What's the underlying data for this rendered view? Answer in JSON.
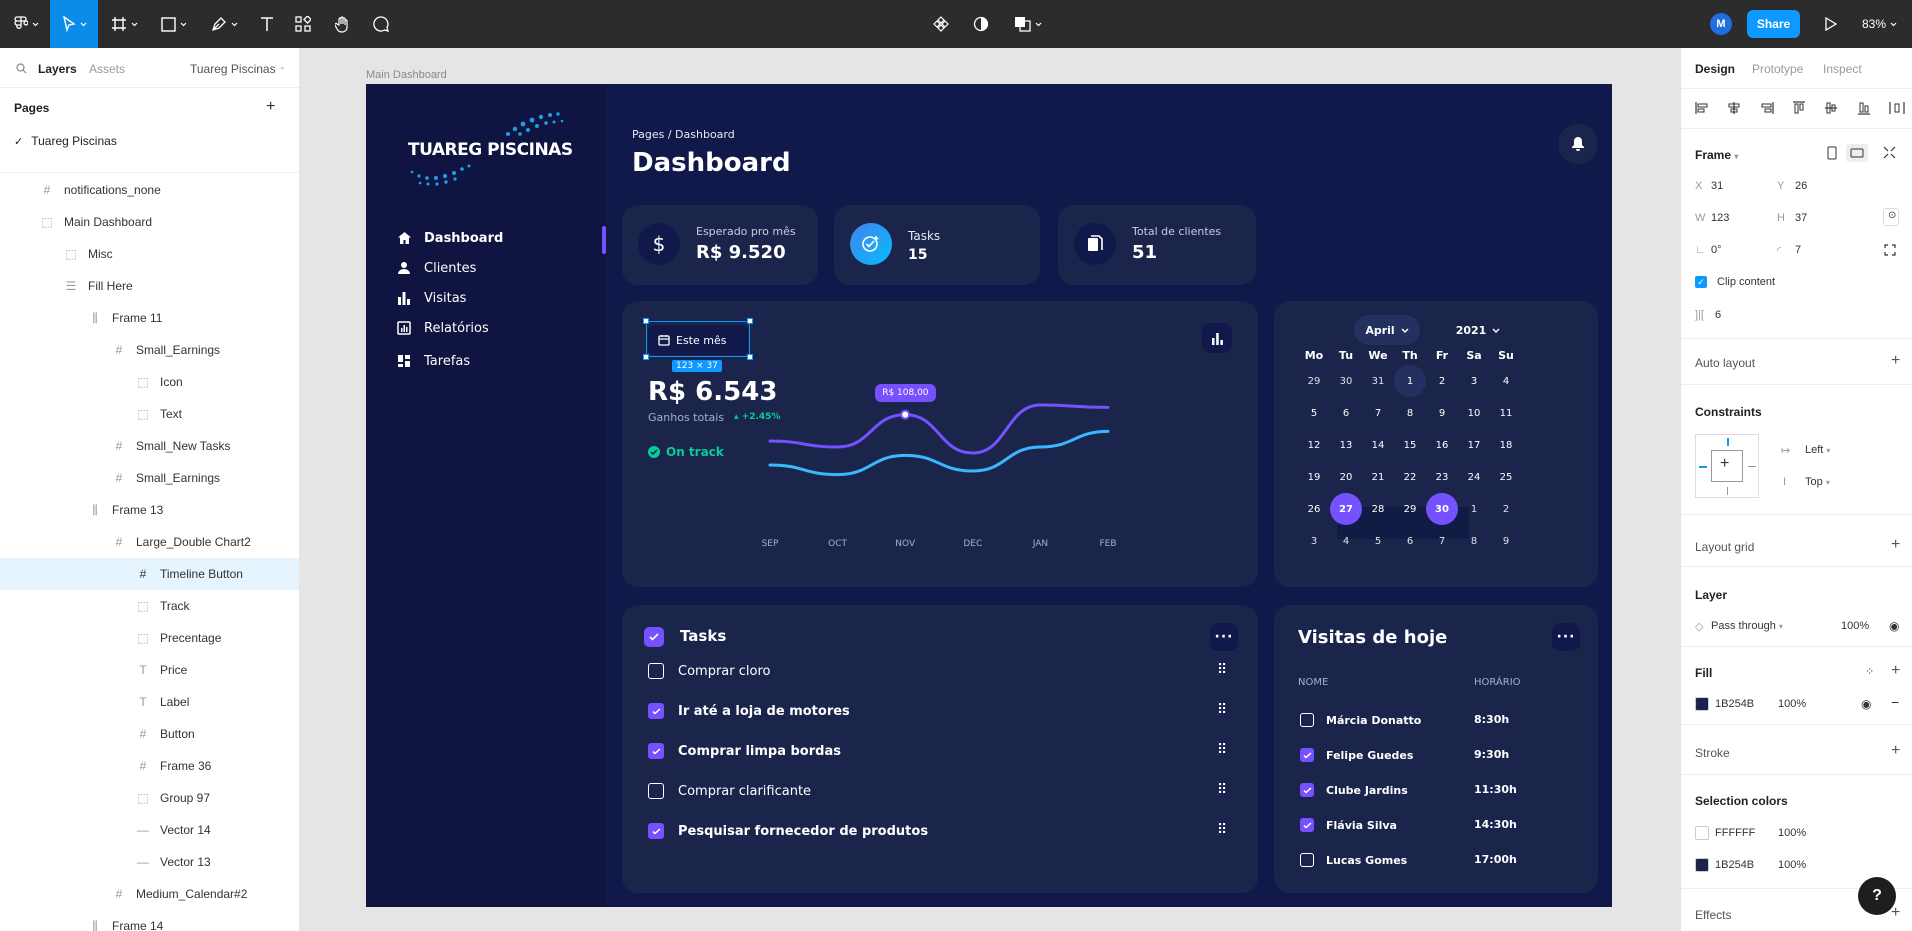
{
  "toolbar": {
    "zoom": "83%",
    "share_label": "Share",
    "user_initial": "M",
    "icons": [
      "figma-menu-icon",
      "move-tool-icon",
      "frame-tool-icon",
      "shape-tool-icon",
      "pen-tool-icon",
      "text-tool-icon",
      "resources-icon",
      "hand-tool-icon",
      "comment-icon",
      "components-icon",
      "contrast-icon",
      "boolean-icon",
      "present-icon"
    ]
  },
  "left_panel": {
    "tabs": {
      "layers": "Layers",
      "assets": "Assets",
      "file": "Tuareg Piscinas"
    },
    "pages_heading": "Pages",
    "pages": [
      "Tuareg Piscinas"
    ],
    "layers": [
      {
        "name": "notifications_none",
        "indent": 0,
        "icon": "hash"
      },
      {
        "name": "Main Dashboard",
        "indent": 0,
        "icon": "dash"
      },
      {
        "name": "Misc",
        "indent": 1,
        "icon": "dash"
      },
      {
        "name": "Fill Here",
        "indent": 1,
        "icon": "lines"
      },
      {
        "name": "Frame 11",
        "indent": 2,
        "icon": "bars"
      },
      {
        "name": "Small_Earnings",
        "indent": 3,
        "icon": "hash"
      },
      {
        "name": "Icon",
        "indent": 4,
        "icon": "dash"
      },
      {
        "name": "Text",
        "indent": 4,
        "icon": "dash"
      },
      {
        "name": "Small_New Tasks",
        "indent": 3,
        "icon": "hash"
      },
      {
        "name": "Small_Earnings",
        "indent": 3,
        "icon": "hash"
      },
      {
        "name": "Frame 13",
        "indent": 2,
        "icon": "bars"
      },
      {
        "name": "Large_Double Chart2",
        "indent": 3,
        "icon": "hash"
      },
      {
        "name": "Timeline Button",
        "indent": 4,
        "icon": "hash",
        "selected": true
      },
      {
        "name": "Track",
        "indent": 4,
        "icon": "dash"
      },
      {
        "name": "Precentage",
        "indent": 4,
        "icon": "dash"
      },
      {
        "name": "Price",
        "indent": 4,
        "icon": "text"
      },
      {
        "name": "Label",
        "indent": 4,
        "icon": "text"
      },
      {
        "name": "Button",
        "indent": 4,
        "icon": "hash"
      },
      {
        "name": "Frame 36",
        "indent": 4,
        "icon": "hash"
      },
      {
        "name": "Group 97",
        "indent": 4,
        "icon": "dash"
      },
      {
        "name": "Vector 14",
        "indent": 4,
        "icon": "vector"
      },
      {
        "name": "Vector 13",
        "indent": 4,
        "icon": "vector"
      },
      {
        "name": "Medium_Calendar#2",
        "indent": 3,
        "icon": "hash"
      },
      {
        "name": "Frame 14",
        "indent": 2,
        "icon": "bars"
      }
    ]
  },
  "right_panel": {
    "tabs": [
      "Design",
      "Prototype",
      "Inspect"
    ],
    "frame_label": "Frame",
    "x": "31",
    "y": "26",
    "w": "123",
    "h": "37",
    "rotation": "0°",
    "radius": "7",
    "clip_content": "Clip content",
    "gap": "6",
    "auto_layout": "Auto layout",
    "constraints": "Constraints",
    "constraint_h": "Left",
    "constraint_v": "Top",
    "layout_grid": "Layout grid",
    "layer": "Layer",
    "blend": "Pass through",
    "opacity": "100%",
    "fill": "Fill",
    "fill_hex": "1B254B",
    "fill_opacity": "100%",
    "stroke": "Stroke",
    "selection_colors": "Selection colors",
    "sel_colors": [
      {
        "hex": "FFFFFF",
        "opacity": "100%",
        "color": "#FFFFFF"
      },
      {
        "hex": "1B254B",
        "opacity": "100%",
        "color": "#1B254B"
      }
    ],
    "effects": "Effects"
  },
  "canvas": {
    "frame_label": "Main Dashboard"
  },
  "dashboard": {
    "logo": "TUAREG PISCINAS",
    "nav": [
      "Dashboard",
      "Clientes",
      "Visitas",
      "Relatórios",
      "Tarefas"
    ],
    "breadcrumb": "Pages / Dashboard",
    "title": "Dashboard",
    "stats": [
      {
        "label": "Esperado pro mês",
        "value": "R$ 9.520",
        "icon": "$"
      },
      {
        "label": "Tasks",
        "value": "15",
        "icon": "check"
      },
      {
        "label": "Total de clientes",
        "value": "51",
        "icon": "file"
      }
    ],
    "chart_card": {
      "timeline_button": "Este mês",
      "size_tag": "123 × 37",
      "price": "R$ 6.543",
      "gain_label": "Ganhos totais",
      "gain_pct": "+2.45%",
      "status": "On track",
      "tooltip": "R$ 108,00"
    },
    "calendar": {
      "month": "April",
      "year": "2021",
      "weekdays": [
        "Mo",
        "Tu",
        "We",
        "Th",
        "Fr",
        "Sa",
        "Su"
      ],
      "weeks": [
        [
          "29",
          "30",
          "31",
          "1",
          "2",
          "3",
          "4"
        ],
        [
          "5",
          "6",
          "7",
          "8",
          "9",
          "10",
          "11"
        ],
        [
          "12",
          "13",
          "14",
          "15",
          "16",
          "17",
          "18"
        ],
        [
          "19",
          "20",
          "21",
          "22",
          "23",
          "24",
          "25"
        ],
        [
          "26",
          "27",
          "28",
          "29",
          "30",
          "1",
          "2"
        ],
        [
          "3",
          "4",
          "5",
          "6",
          "7",
          "8",
          "9"
        ]
      ]
    },
    "tasks": {
      "title": "Tasks",
      "items": [
        {
          "label": "Comprar cloro",
          "checked": false
        },
        {
          "label": "Ir até a loja de motores",
          "checked": true
        },
        {
          "label": "Comprar limpa bordas",
          "checked": true
        },
        {
          "label": "Comprar clarificante",
          "checked": false
        },
        {
          "label": "Pesquisar fornecedor de produtos",
          "checked": true
        }
      ]
    },
    "visits": {
      "title": "Visitas de hoje",
      "col_name": "NOME",
      "col_time": "HORÁRIO",
      "rows": [
        {
          "name": "Márcia Donatto",
          "time": "8:30h",
          "checked": false
        },
        {
          "name": "Felipe Guedes",
          "time": "9:30h",
          "checked": true
        },
        {
          "name": "Clube Jardins",
          "time": "11:30h",
          "checked": true
        },
        {
          "name": "Flávia Silva",
          "time": "14:30h",
          "checked": true
        },
        {
          "name": "Lucas Gomes",
          "time": "17:00h",
          "checked": false
        }
      ]
    }
  },
  "chart_data": {
    "type": "line",
    "categories": [
      "SEP",
      "OCT",
      "NOV",
      "DEC",
      "JAN",
      "FEB"
    ],
    "series": [
      {
        "values": [
          30,
          25,
          52,
          20,
          60,
          58
        ],
        "color": "#7551FF"
      },
      {
        "values": [
          10,
          2,
          18,
          5,
          25,
          38
        ],
        "color": "#39B8FF"
      }
    ],
    "ylim": [
      -20,
      80
    ],
    "grid": false
  },
  "colors": {
    "accent": "#7551FF",
    "frame_bg": "#11194A",
    "card_bg": "#1B254B",
    "success": "#05CD99",
    "figma_blue": "#0D99FF"
  }
}
